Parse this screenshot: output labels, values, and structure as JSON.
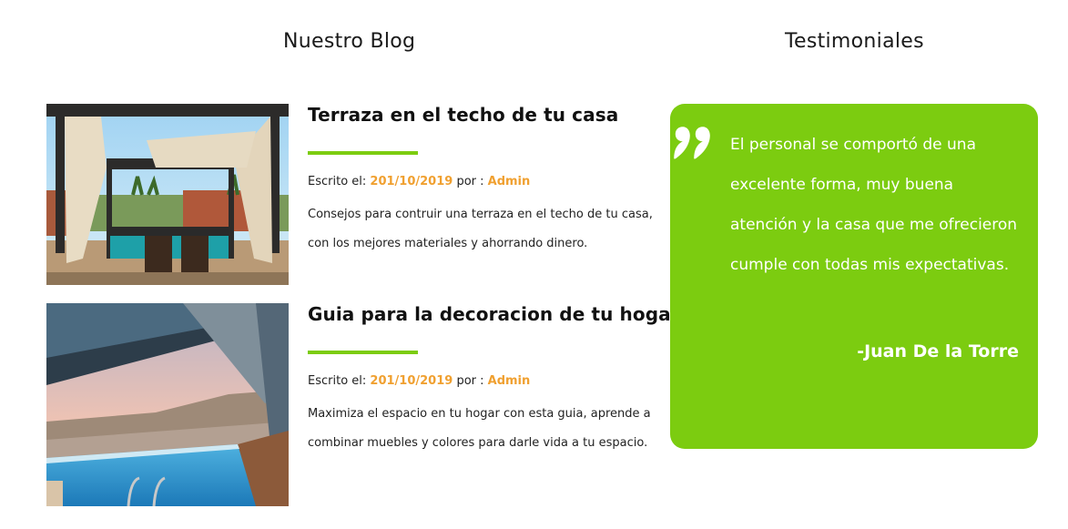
{
  "blog": {
    "heading": "Nuestro Blog",
    "written_label": "Escrito el: ",
    "by_label": " por : ",
    "posts": [
      {
        "title": "Terraza en el techo de tu casa",
        "date": "201/10/2019",
        "author": "Admin",
        "excerpt": "Consejos para contruir una terraza en el techo de tu casa, con los mejores materiales y ahorrando dinero."
      },
      {
        "title": "Guia para la decoracion de tu hogar",
        "date": "201/10/2019",
        "author": "Admin",
        "excerpt": "Maximiza el espacio en tu hogar con esta guia, aprende a combinar muebles y colores para darle vida a tu espacio."
      }
    ]
  },
  "testimonials": {
    "heading": "Testimoniales",
    "quote_icon": "quote-icon",
    "text": "El personal se comportó de una excelente forma, muy buena atención y la casa que me ofrecieron cumple con todas mis expectativas.",
    "author": "-Juan De la Torre"
  },
  "colors": {
    "accent_green": "#7ccc10",
    "accent_orange": "#f0a030",
    "text_dark": "#111111"
  }
}
